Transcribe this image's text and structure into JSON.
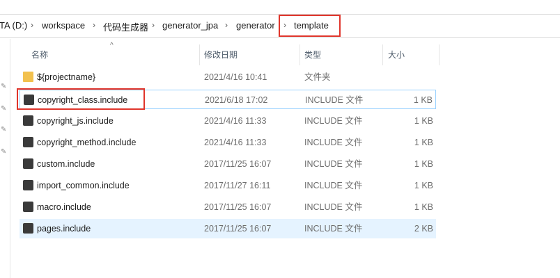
{
  "breadcrumb": {
    "items": [
      "TA (D:)",
      "workspace",
      "代码生成器",
      "generator_jpa",
      "generator",
      "template"
    ]
  },
  "columns": {
    "name": "名称",
    "modified": "修改日期",
    "type": "类型",
    "size": "大小"
  },
  "files": [
    {
      "name": "${projectname}",
      "modified": "2021/4/16 10:41",
      "type": "文件夹",
      "size": "",
      "icon": "folder-icon"
    },
    {
      "name": "copyright_class.include",
      "modified": "2021/6/18 17:02",
      "type": "INCLUDE 文件",
      "size": "1 KB",
      "icon": "sublime-file-icon"
    },
    {
      "name": "copyright_js.include",
      "modified": "2021/4/16 11:33",
      "type": "INCLUDE 文件",
      "size": "1 KB",
      "icon": "sublime-file-icon"
    },
    {
      "name": "copyright_method.include",
      "modified": "2021/4/16 11:33",
      "type": "INCLUDE 文件",
      "size": "1 KB",
      "icon": "sublime-file-icon"
    },
    {
      "name": "custom.include",
      "modified": "2017/11/25 16:07",
      "type": "INCLUDE 文件",
      "size": "1 KB",
      "icon": "sublime-file-icon"
    },
    {
      "name": "import_common.include",
      "modified": "2017/11/27 16:11",
      "type": "INCLUDE 文件",
      "size": "1 KB",
      "icon": "sublime-file-icon"
    },
    {
      "name": "macro.include",
      "modified": "2017/11/25 16:07",
      "type": "INCLUDE 文件",
      "size": "1 KB",
      "icon": "sublime-file-icon"
    },
    {
      "name": "pages.include",
      "modified": "2017/11/25 16:07",
      "type": "INCLUDE 文件",
      "size": "2 KB",
      "icon": "sublime-file-icon"
    }
  ],
  "colors": {
    "highlight": "#e0352b",
    "selection": "#e5f3ff",
    "focus_border": "#99d1ff"
  }
}
